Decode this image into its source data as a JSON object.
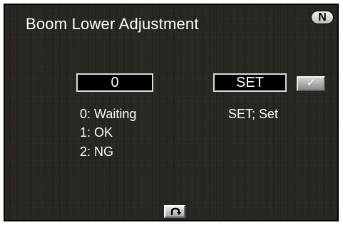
{
  "screen": {
    "title": "Boom Lower Adjustment",
    "mode_indicator": "N"
  },
  "status_field": {
    "value": "0"
  },
  "set_field": {
    "value": "SET"
  },
  "confirm_button": {
    "icon": "check-icon",
    "glyph": "✓"
  },
  "status_legend": [
    {
      "text": "0: Waiting"
    },
    {
      "text": "1: OK"
    },
    {
      "text": "2: NG"
    }
  ],
  "set_hint": "SET; Set",
  "back_button": {
    "icon": "return-arrow-icon"
  },
  "colors": {
    "background": "#2a2723",
    "text": "#ffffff",
    "field_background": "#000000",
    "button_face": "#b0b0b0"
  }
}
